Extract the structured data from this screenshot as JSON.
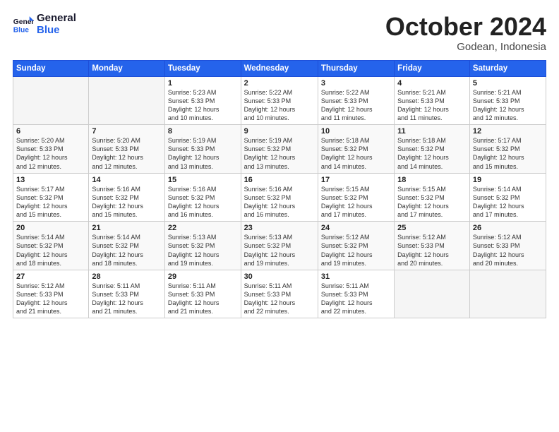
{
  "header": {
    "logo_general": "General",
    "logo_blue": "Blue",
    "month_title": "October 2024",
    "location": "Godean, Indonesia"
  },
  "days_of_week": [
    "Sunday",
    "Monday",
    "Tuesday",
    "Wednesday",
    "Thursday",
    "Friday",
    "Saturday"
  ],
  "weeks": [
    [
      {
        "day": "",
        "info": ""
      },
      {
        "day": "",
        "info": ""
      },
      {
        "day": "1",
        "info": "Sunrise: 5:23 AM\nSunset: 5:33 PM\nDaylight: 12 hours\nand 10 minutes."
      },
      {
        "day": "2",
        "info": "Sunrise: 5:22 AM\nSunset: 5:33 PM\nDaylight: 12 hours\nand 10 minutes."
      },
      {
        "day": "3",
        "info": "Sunrise: 5:22 AM\nSunset: 5:33 PM\nDaylight: 12 hours\nand 11 minutes."
      },
      {
        "day": "4",
        "info": "Sunrise: 5:21 AM\nSunset: 5:33 PM\nDaylight: 12 hours\nand 11 minutes."
      },
      {
        "day": "5",
        "info": "Sunrise: 5:21 AM\nSunset: 5:33 PM\nDaylight: 12 hours\nand 12 minutes."
      }
    ],
    [
      {
        "day": "6",
        "info": "Sunrise: 5:20 AM\nSunset: 5:33 PM\nDaylight: 12 hours\nand 12 minutes."
      },
      {
        "day": "7",
        "info": "Sunrise: 5:20 AM\nSunset: 5:33 PM\nDaylight: 12 hours\nand 12 minutes."
      },
      {
        "day": "8",
        "info": "Sunrise: 5:19 AM\nSunset: 5:33 PM\nDaylight: 12 hours\nand 13 minutes."
      },
      {
        "day": "9",
        "info": "Sunrise: 5:19 AM\nSunset: 5:32 PM\nDaylight: 12 hours\nand 13 minutes."
      },
      {
        "day": "10",
        "info": "Sunrise: 5:18 AM\nSunset: 5:32 PM\nDaylight: 12 hours\nand 14 minutes."
      },
      {
        "day": "11",
        "info": "Sunrise: 5:18 AM\nSunset: 5:32 PM\nDaylight: 12 hours\nand 14 minutes."
      },
      {
        "day": "12",
        "info": "Sunrise: 5:17 AM\nSunset: 5:32 PM\nDaylight: 12 hours\nand 15 minutes."
      }
    ],
    [
      {
        "day": "13",
        "info": "Sunrise: 5:17 AM\nSunset: 5:32 PM\nDaylight: 12 hours\nand 15 minutes."
      },
      {
        "day": "14",
        "info": "Sunrise: 5:16 AM\nSunset: 5:32 PM\nDaylight: 12 hours\nand 15 minutes."
      },
      {
        "day": "15",
        "info": "Sunrise: 5:16 AM\nSunset: 5:32 PM\nDaylight: 12 hours\nand 16 minutes."
      },
      {
        "day": "16",
        "info": "Sunrise: 5:16 AM\nSunset: 5:32 PM\nDaylight: 12 hours\nand 16 minutes."
      },
      {
        "day": "17",
        "info": "Sunrise: 5:15 AM\nSunset: 5:32 PM\nDaylight: 12 hours\nand 17 minutes."
      },
      {
        "day": "18",
        "info": "Sunrise: 5:15 AM\nSunset: 5:32 PM\nDaylight: 12 hours\nand 17 minutes."
      },
      {
        "day": "19",
        "info": "Sunrise: 5:14 AM\nSunset: 5:32 PM\nDaylight: 12 hours\nand 17 minutes."
      }
    ],
    [
      {
        "day": "20",
        "info": "Sunrise: 5:14 AM\nSunset: 5:32 PM\nDaylight: 12 hours\nand 18 minutes."
      },
      {
        "day": "21",
        "info": "Sunrise: 5:14 AM\nSunset: 5:32 PM\nDaylight: 12 hours\nand 18 minutes."
      },
      {
        "day": "22",
        "info": "Sunrise: 5:13 AM\nSunset: 5:32 PM\nDaylight: 12 hours\nand 19 minutes."
      },
      {
        "day": "23",
        "info": "Sunrise: 5:13 AM\nSunset: 5:32 PM\nDaylight: 12 hours\nand 19 minutes."
      },
      {
        "day": "24",
        "info": "Sunrise: 5:12 AM\nSunset: 5:32 PM\nDaylight: 12 hours\nand 19 minutes."
      },
      {
        "day": "25",
        "info": "Sunrise: 5:12 AM\nSunset: 5:33 PM\nDaylight: 12 hours\nand 20 minutes."
      },
      {
        "day": "26",
        "info": "Sunrise: 5:12 AM\nSunset: 5:33 PM\nDaylight: 12 hours\nand 20 minutes."
      }
    ],
    [
      {
        "day": "27",
        "info": "Sunrise: 5:12 AM\nSunset: 5:33 PM\nDaylight: 12 hours\nand 21 minutes."
      },
      {
        "day": "28",
        "info": "Sunrise: 5:11 AM\nSunset: 5:33 PM\nDaylight: 12 hours\nand 21 minutes."
      },
      {
        "day": "29",
        "info": "Sunrise: 5:11 AM\nSunset: 5:33 PM\nDaylight: 12 hours\nand 21 minutes."
      },
      {
        "day": "30",
        "info": "Sunrise: 5:11 AM\nSunset: 5:33 PM\nDaylight: 12 hours\nand 22 minutes."
      },
      {
        "day": "31",
        "info": "Sunrise: 5:11 AM\nSunset: 5:33 PM\nDaylight: 12 hours\nand 22 minutes."
      },
      {
        "day": "",
        "info": ""
      },
      {
        "day": "",
        "info": ""
      }
    ]
  ]
}
